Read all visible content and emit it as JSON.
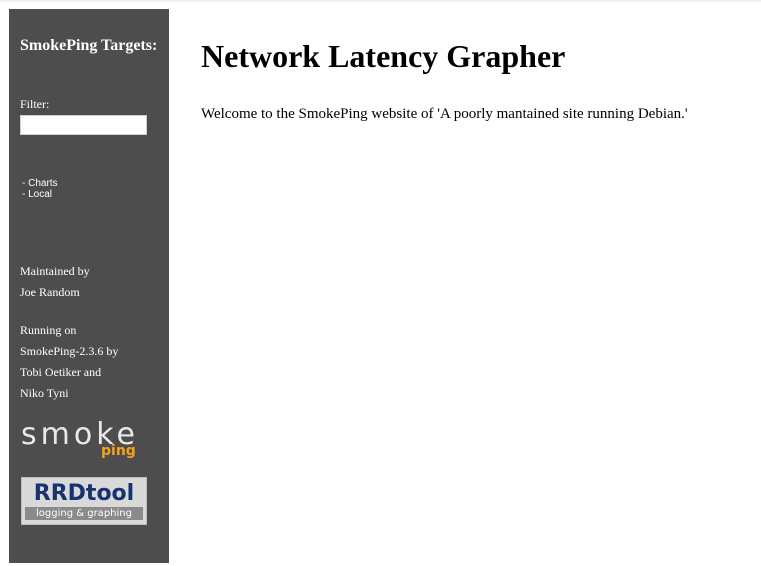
{
  "sidebar": {
    "title": "SmokePing Targets:",
    "filter_label": "Filter:",
    "filter_value": "",
    "menu": [
      "- Charts",
      "- Local"
    ],
    "maintained_line1": "Maintained by",
    "maintained_line2": "Joe Random",
    "running_lines": [
      "Running on",
      "SmokePing-2.3.6 by",
      "Tobi Oetiker and",
      "Niko Tyni"
    ],
    "logos": {
      "smoke": "smoke",
      "ping": "ping",
      "rrd": "RRDtool",
      "rrd_tag": "logging & graphing"
    }
  },
  "main": {
    "title": "Network Latency Grapher",
    "welcome": "Welcome to the SmokePing website of 'A poorly mantained site running Debian.'"
  },
  "colors": {
    "sidebar_bg": "#4d4d4d",
    "ping_orange": "#f7a21b",
    "rrd_blue": "#17326e"
  }
}
